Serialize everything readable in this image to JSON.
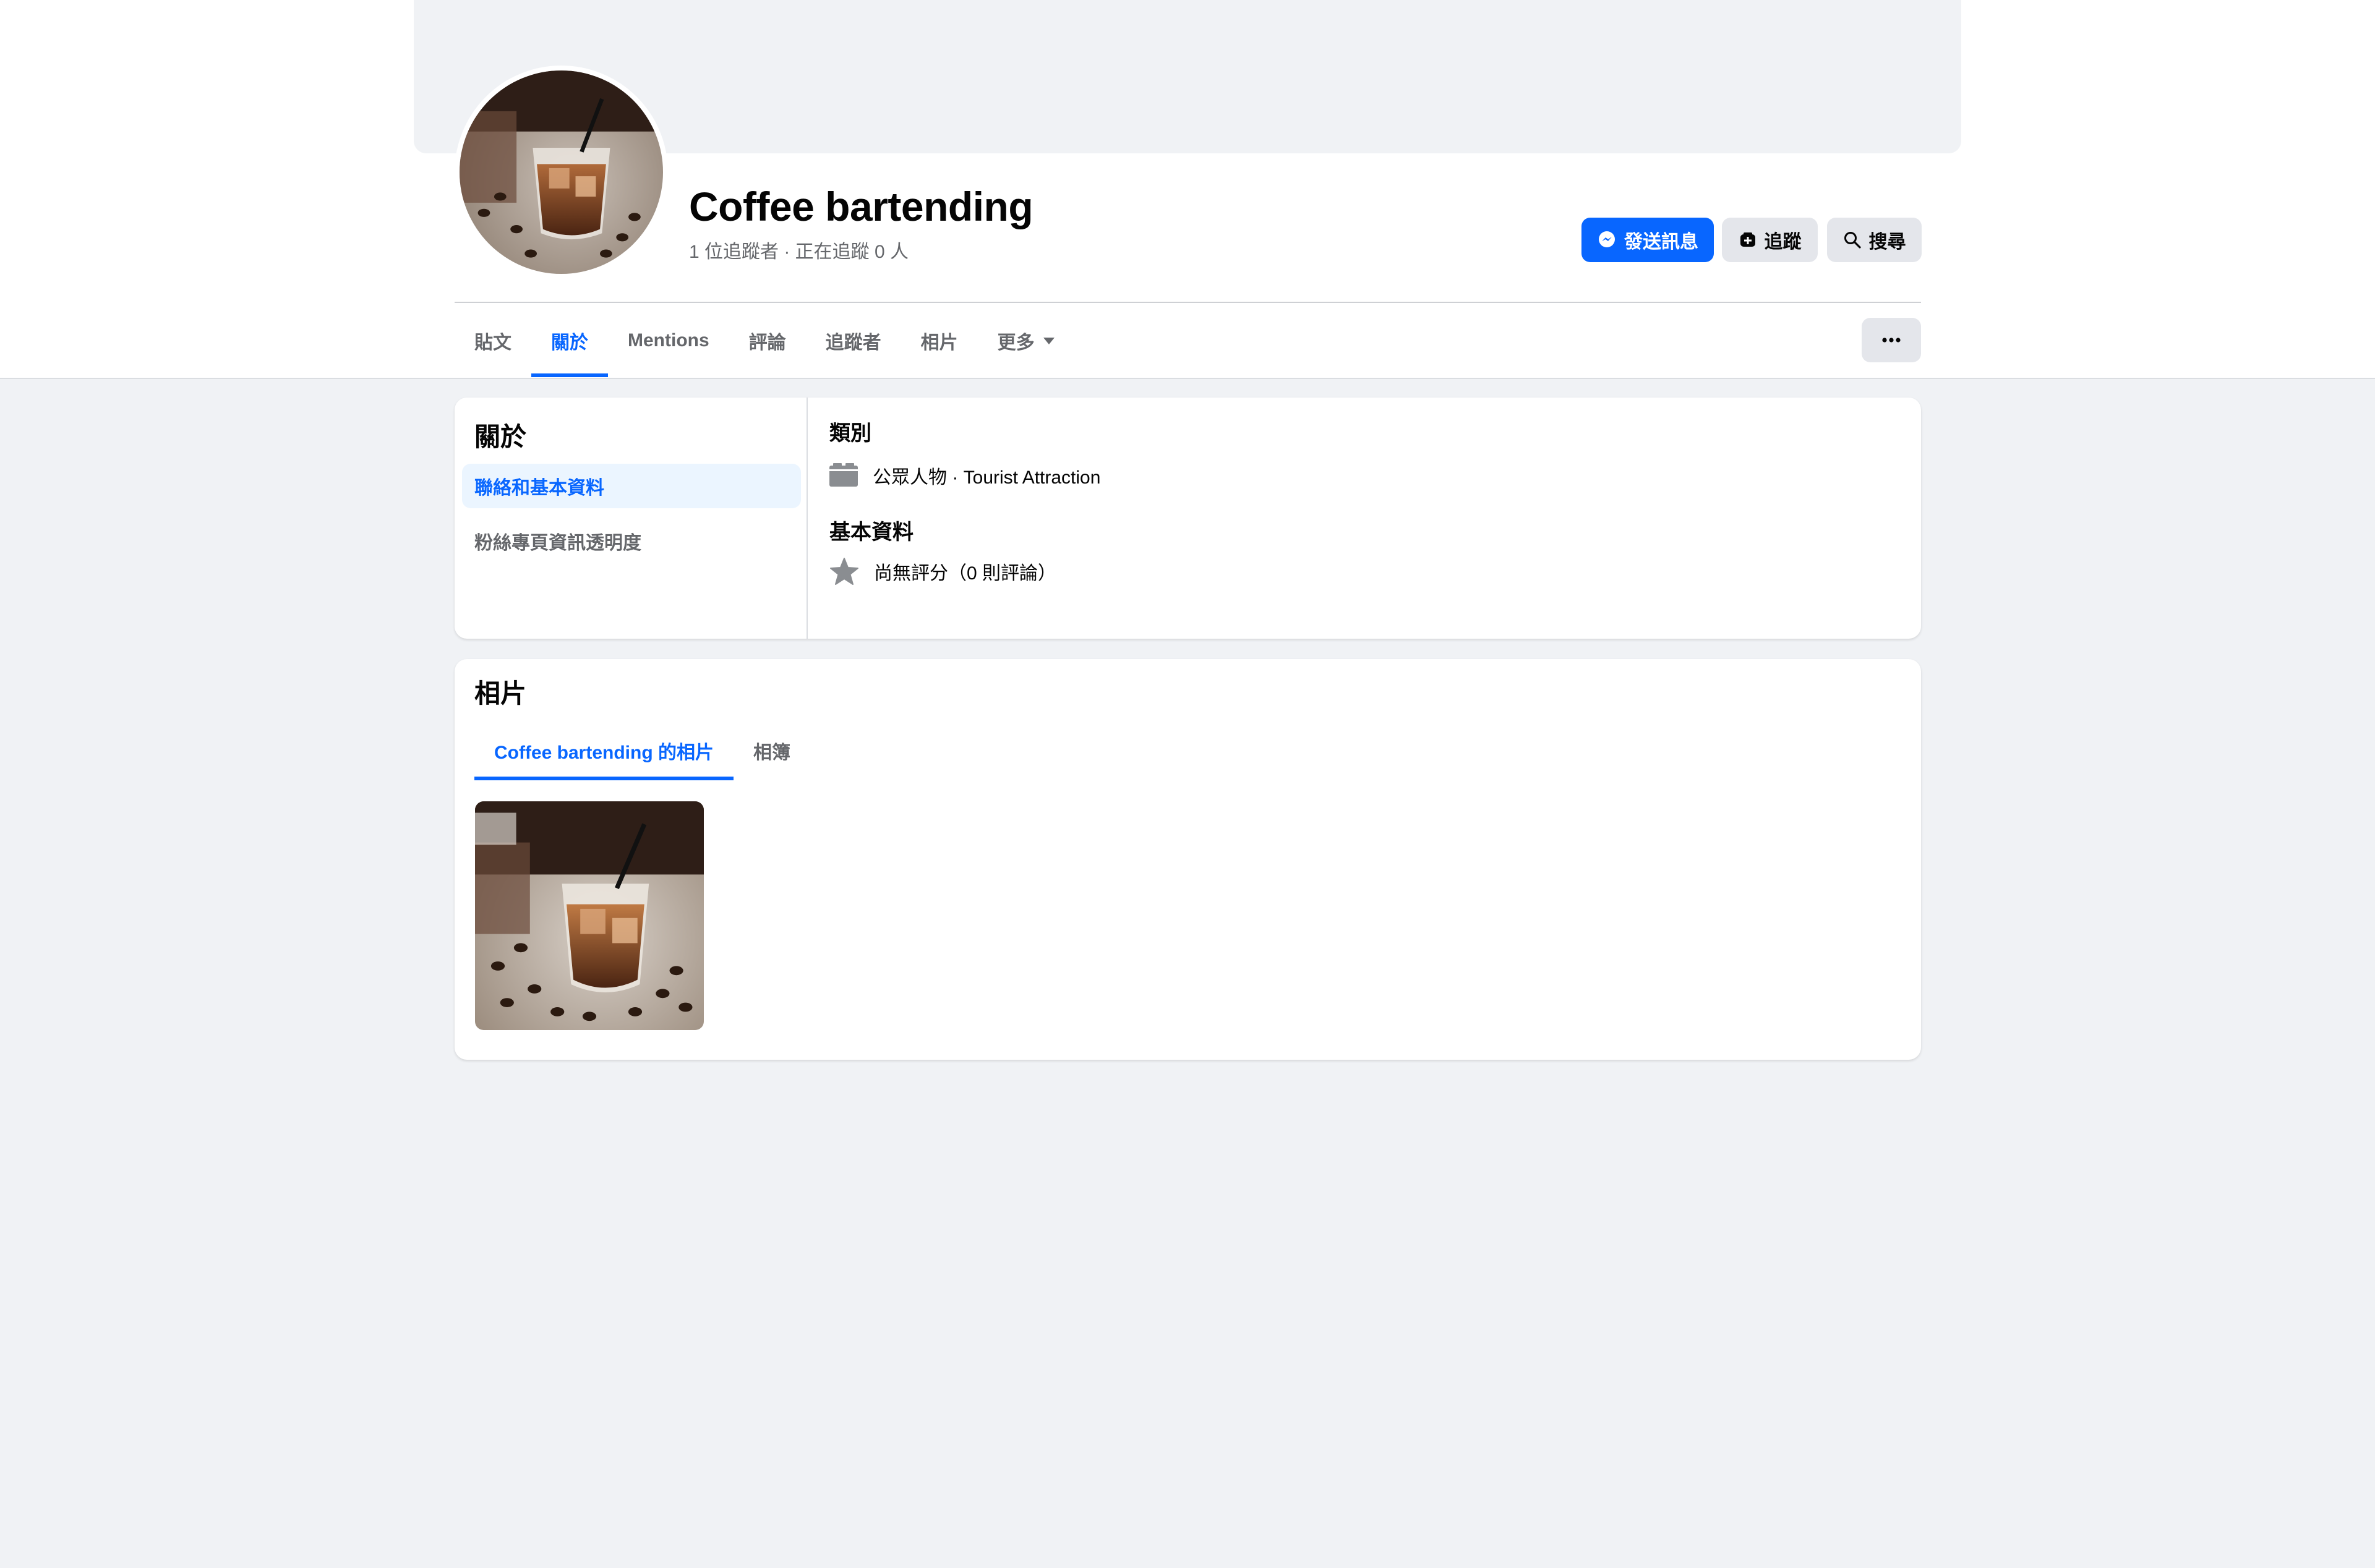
{
  "profile": {
    "name": "Coffee bartending",
    "stats": "1 位追蹤者 · 正在追蹤 0 人"
  },
  "actions": {
    "message_label": "發送訊息",
    "follow_label": "追蹤",
    "search_label": "搜尋"
  },
  "tabs": [
    {
      "label": "貼文"
    },
    {
      "label": "關於"
    },
    {
      "label": "Mentions"
    },
    {
      "label": "評論"
    },
    {
      "label": "追蹤者"
    },
    {
      "label": "相片"
    },
    {
      "label": "更多"
    }
  ],
  "active_tab": "關於",
  "about": {
    "title": "關於",
    "nav": [
      {
        "label": "聯絡和基本資料"
      },
      {
        "label": "粉絲專頁資訊透明度"
      }
    ],
    "category_title": "類別",
    "category_value": "公眾人物 · Tourist Attraction",
    "basic_title": "基本資料",
    "rating_value": "尚無評分（0 則評論）"
  },
  "photos": {
    "title": "相片",
    "tabs": [
      {
        "label": "Coffee bartending 的相片"
      },
      {
        "label": "相簿"
      }
    ]
  },
  "icons": [
    "messenger-icon",
    "follow-icon",
    "search-icon",
    "caret-down-icon",
    "more-dots-icon",
    "category-icon",
    "star-icon"
  ],
  "colors": {
    "accent": "#0866ff",
    "page_background": "#f0f2f5",
    "secondary_text": "#65676b",
    "button_gray": "#e4e6eb",
    "selected_nav_bg": "#ebf5ff"
  }
}
